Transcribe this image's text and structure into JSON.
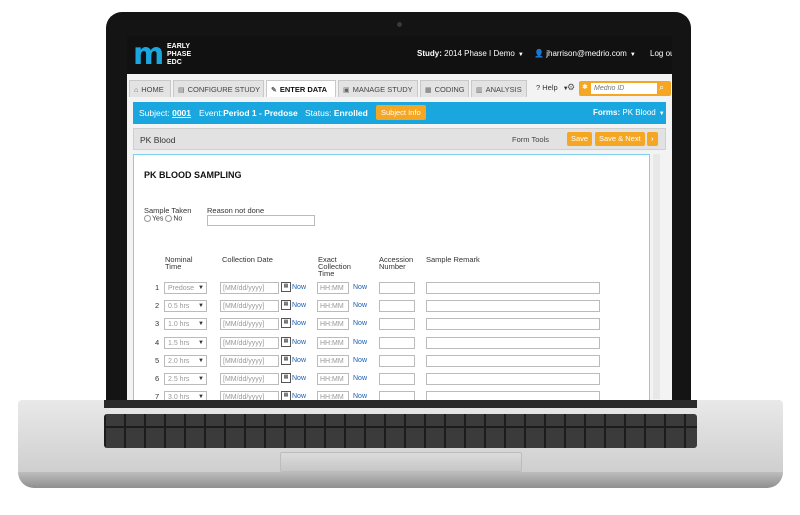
{
  "header": {
    "logo_mark": "m",
    "logo_text": "EARLY\nPHASE\nEDC",
    "study_label": "Study:",
    "study_value": "2014 Phase I Demo",
    "user": "jharrison@medrio.com",
    "logout": "Log out"
  },
  "nav": {
    "tabs": [
      {
        "label": "HOME",
        "icon": "home-icon"
      },
      {
        "label": "CONFIGURE STUDY",
        "icon": "configure-icon"
      },
      {
        "label": "ENTER DATA",
        "icon": "edit-icon"
      },
      {
        "label": "MANAGE STUDY",
        "icon": "manage-icon"
      },
      {
        "label": "CODING",
        "icon": "coding-icon"
      },
      {
        "label": "ANALYSIS",
        "icon": "analysis-icon"
      }
    ],
    "help": "Help",
    "search_placeholder": "Medrio ID"
  },
  "subject_bar": {
    "subject_label": "Subject:",
    "subject_value": "0001",
    "event_label": "Event:",
    "event_value": "Period 1 - Predose",
    "status_label": "Status:",
    "status_value": "Enrolled",
    "subject_info": "Subject Info",
    "forms_label": "Forms:",
    "forms_value": "PK Blood"
  },
  "form_header": {
    "title": "PK Blood",
    "tools": "Form Tools",
    "save": "Save",
    "save_next": "Save & Next",
    "next": "›"
  },
  "form": {
    "heading": "PK BLOOD SAMPLING",
    "sample_taken": "Sample Taken",
    "reason_not_done": "Reason not done",
    "yes": "Yes",
    "no": "No",
    "columns": {
      "nominal_time": "Nominal\nTime",
      "collection_date": "Collection Date",
      "exact_time": "Exact\nCollection\nTime",
      "accession": "Accession\nNumber",
      "remark": "Sample Remark"
    },
    "date_placeholder": "[MM/dd/yyyy]",
    "time_placeholder": "HH:MM",
    "now": "Now",
    "rows": [
      {
        "num": "1",
        "nominal": "Predose"
      },
      {
        "num": "2",
        "nominal": "0.5 hrs"
      },
      {
        "num": "3",
        "nominal": "1.0 hrs"
      },
      {
        "num": "4",
        "nominal": "1.5 hrs"
      },
      {
        "num": "5",
        "nominal": "2.0 hrs"
      },
      {
        "num": "6",
        "nominal": "2.5 hrs"
      },
      {
        "num": "7",
        "nominal": "3.0 hrs"
      }
    ]
  }
}
